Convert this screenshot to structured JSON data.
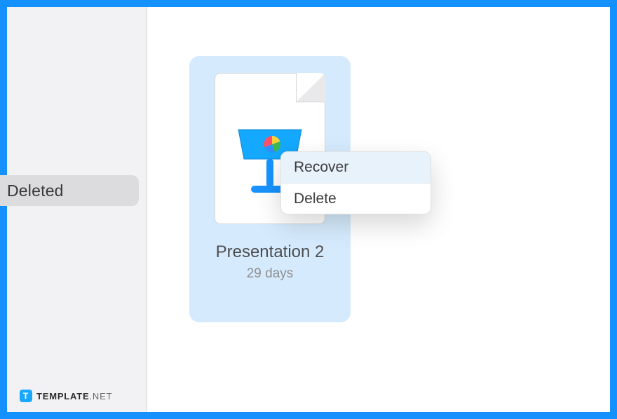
{
  "sidebar": {
    "selected_label": "Deleted"
  },
  "file": {
    "name": "Presentation 2",
    "subtitle": "29 days"
  },
  "context_menu": {
    "items": [
      {
        "label": "Recover"
      },
      {
        "label": "Delete"
      }
    ]
  },
  "watermark": {
    "bold": "TEMPLATE",
    "light": ".NET"
  }
}
